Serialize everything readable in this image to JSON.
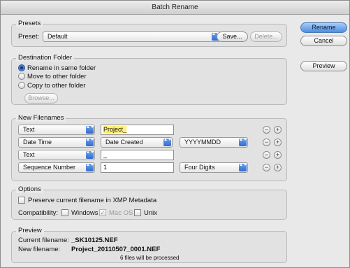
{
  "window": {
    "title": "Batch Rename"
  },
  "buttons": {
    "rename": "Rename",
    "cancel": "Cancel",
    "preview": "Preview"
  },
  "presets": {
    "group_label": "Presets",
    "preset_label": "Preset:",
    "preset_value": "Default",
    "save": "Save...",
    "delete": "Delete..."
  },
  "destination": {
    "group_label": "Destination Folder",
    "option_same": "Rename in same folder",
    "option_move": "Move to other folder",
    "option_copy": "Copy to other folder",
    "browse": "Browse...",
    "selected": "same"
  },
  "new_filenames": {
    "group_label": "New Filenames",
    "rows": [
      {
        "type": "Text",
        "field": "Project_"
      },
      {
        "type": "Date Time",
        "option": "Date Created",
        "format": "YYYYMMDD"
      },
      {
        "type": "Text",
        "field": "_"
      },
      {
        "type": "Sequence Number",
        "field": "1",
        "format": "Four Digits"
      }
    ],
    "minus_glyph": "−",
    "plus_glyph": "+"
  },
  "options": {
    "group_label": "Options",
    "preserve_label": "Preserve current filename in XMP Metadata",
    "preserve_checked": false,
    "compat_label": "Compatibility:",
    "compat_windows": "Windows",
    "compat_windows_checked": false,
    "compat_macos": "Mac OS",
    "compat_macos_checked": true,
    "compat_unix": "Unix",
    "compat_unix_checked": false,
    "check_glyph": "✓"
  },
  "preview": {
    "group_label": "Preview",
    "current_label": "Current filename:",
    "current_value": "_SK10125.NEF",
    "new_label": "New filename:",
    "new_value": "Project_20110507_0001.NEF",
    "files_note": "6 files will be processed"
  },
  "icons": {
    "popup_arrows": "▲▼"
  }
}
